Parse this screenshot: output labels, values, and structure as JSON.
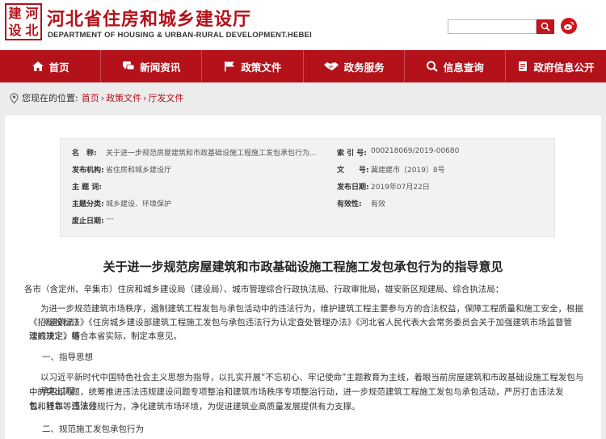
{
  "header": {
    "logo_chars": [
      "建",
      "河",
      "设",
      "北"
    ],
    "title": "河北省住房和城乡建设厅",
    "subtitle": "DEPARTMENT OF HOUSING & URBAN-RURAL DEVELOPMENT.HEBEI",
    "search_placeholder": "",
    "brand_color": "#b3121a"
  },
  "nav": [
    {
      "label": "首页",
      "icon": "home-icon"
    },
    {
      "label": "新闻资讯",
      "icon": "chat-icon"
    },
    {
      "label": "政策文件",
      "icon": "flag-icon"
    },
    {
      "label": "政务服务",
      "icon": "handshake-icon"
    },
    {
      "label": "信息查询",
      "icon": "search-icon"
    },
    {
      "label": "政府信息公开",
      "icon": "document-icon"
    }
  ],
  "breadcrumb": {
    "prefix": "您现在的位置:",
    "items": [
      "首页",
      "政策文件",
      "厅发文件"
    ]
  },
  "meta": {
    "name_label": "名　称:",
    "name_value": "关于进一步规范房屋建筑和市政基础设施工程施工发包承包行为...",
    "index_label": "索 引 号:",
    "index_value": "000218069/2019-00680",
    "org_label": "发布机构:",
    "org_value": "省住房和城乡建设厅",
    "docno_label": "文　　号:",
    "docno_value": "冀建建市〔2019〕8号",
    "keywords_label": "主 题 词:",
    "keywords_value": "",
    "date_label": "发布日期:",
    "date_value": "2019年07月22日",
    "category_label": "主题分类:",
    "category_value": "城乡建设、环境保护",
    "valid_label": "有效性:",
    "valid_value": "有效",
    "repeal_label": "废止日期:",
    "repeal_value": "---"
  },
  "document": {
    "title": "关于进一步规范房屋建筑和市政基础设施工程施工发包承包行为的指导意见",
    "recipients": "各市（含定州、辛集市）住房和城乡建设局（建设局）、城市管理综合行政执法局、行政审批局，雄安新区规建局、综合执法局：",
    "para1_line1": "为进一步规范建筑市场秩序，遏制建筑工程发包与承包活动中的违法行为，维护建筑工程主要参与方的合法权益，保障工程质量和施工安全，根据《建筑法》",
    "para1_line2": "《招标投标法》《住房城乡建设部建筑工程施工发包与承包违法行为认定查处管理办法》《河北省人民代表大会常务委员会关于加强建筑市场监督管理的决定》等",
    "para1_line3": "法规规定，结合本省实际，制定本意见。",
    "section1": "一、指导思想",
    "para2_line1": "以习近平新时代中国特色社会主义思想为指导，以扎实开展“不忘初心、牢记使命”主题教育为主线，着眼当前房屋建筑和市政基础设施工程发包与承包过程",
    "para2_line2": "中的突出问题，统筹推进违法违规建设问题专项整治和建筑市场秩序专项整治行动，进一步规范建筑工程施工发包与承包活动，严厉打击违法发包、转包、违法分",
    "para2_line3": "包和挂靠等违法违规行为，净化建筑市场环境，为促进建筑业高质量发展提供有力支撑。",
    "section2": "二、规范施工发包承包行为"
  }
}
